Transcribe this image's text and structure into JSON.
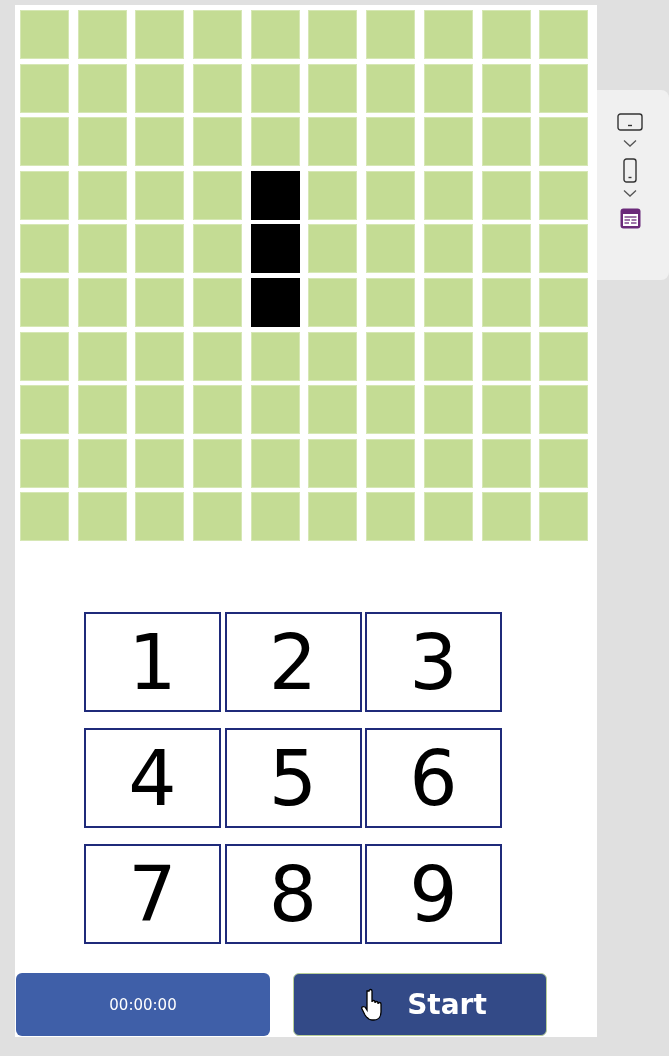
{
  "grid": {
    "rows": [
      {
        "cells": [
          {
            "filled": false
          },
          {
            "filled": false
          },
          {
            "filled": false
          },
          {
            "filled": false
          },
          {
            "filled": false
          },
          {
            "filled": false
          },
          {
            "filled": false
          },
          {
            "filled": false
          },
          {
            "filled": false
          },
          {
            "filled": false
          }
        ]
      },
      {
        "cells": [
          {
            "filled": false
          },
          {
            "filled": false
          },
          {
            "filled": false
          },
          {
            "filled": false
          },
          {
            "filled": false
          },
          {
            "filled": false
          },
          {
            "filled": false
          },
          {
            "filled": false
          },
          {
            "filled": false
          },
          {
            "filled": false
          }
        ]
      },
      {
        "cells": [
          {
            "filled": false
          },
          {
            "filled": false
          },
          {
            "filled": false
          },
          {
            "filled": false
          },
          {
            "filled": false
          },
          {
            "filled": false
          },
          {
            "filled": false
          },
          {
            "filled": false
          },
          {
            "filled": false
          },
          {
            "filled": false
          }
        ]
      },
      {
        "cells": [
          {
            "filled": false
          },
          {
            "filled": false
          },
          {
            "filled": false
          },
          {
            "filled": false
          },
          {
            "filled": true
          },
          {
            "filled": false
          },
          {
            "filled": false
          },
          {
            "filled": false
          },
          {
            "filled": false
          },
          {
            "filled": false
          }
        ]
      },
      {
        "cells": [
          {
            "filled": false
          },
          {
            "filled": false
          },
          {
            "filled": false
          },
          {
            "filled": false
          },
          {
            "filled": true
          },
          {
            "filled": false
          },
          {
            "filled": false
          },
          {
            "filled": false
          },
          {
            "filled": false
          },
          {
            "filled": false
          }
        ]
      },
      {
        "cells": [
          {
            "filled": false
          },
          {
            "filled": false
          },
          {
            "filled": false
          },
          {
            "filled": false
          },
          {
            "filled": true
          },
          {
            "filled": false
          },
          {
            "filled": false
          },
          {
            "filled": false
          },
          {
            "filled": false
          },
          {
            "filled": false
          }
        ]
      },
      {
        "cells": [
          {
            "filled": false
          },
          {
            "filled": false
          },
          {
            "filled": false
          },
          {
            "filled": false
          },
          {
            "filled": false
          },
          {
            "filled": false
          },
          {
            "filled": false
          },
          {
            "filled": false
          },
          {
            "filled": false
          },
          {
            "filled": false
          }
        ]
      },
      {
        "cells": [
          {
            "filled": false
          },
          {
            "filled": false
          },
          {
            "filled": false
          },
          {
            "filled": false
          },
          {
            "filled": false
          },
          {
            "filled": false
          },
          {
            "filled": false
          },
          {
            "filled": false
          },
          {
            "filled": false
          },
          {
            "filled": false
          }
        ]
      },
      {
        "cells": [
          {
            "filled": false
          },
          {
            "filled": false
          },
          {
            "filled": false
          },
          {
            "filled": false
          },
          {
            "filled": false
          },
          {
            "filled": false
          },
          {
            "filled": false
          },
          {
            "filled": false
          },
          {
            "filled": false
          },
          {
            "filled": false
          }
        ]
      },
      {
        "cells": [
          {
            "filled": false
          },
          {
            "filled": false
          },
          {
            "filled": false
          },
          {
            "filled": false
          },
          {
            "filled": false
          },
          {
            "filled": false
          },
          {
            "filled": false
          },
          {
            "filled": false
          },
          {
            "filled": false
          },
          {
            "filled": false
          }
        ]
      }
    ]
  },
  "keypad": [
    "1",
    "2",
    "3",
    "4",
    "5",
    "6",
    "7",
    "8",
    "9"
  ],
  "timer": "00:00:00",
  "start_button": "Start"
}
